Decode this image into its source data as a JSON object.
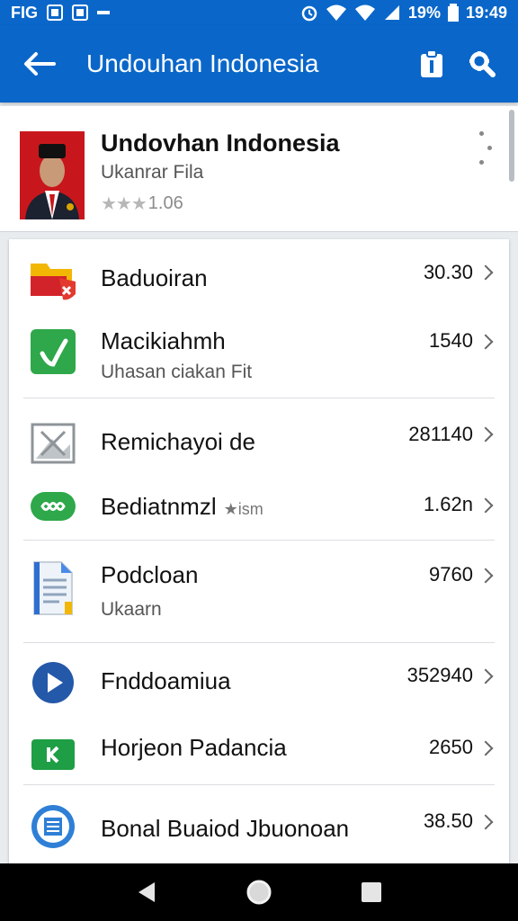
{
  "status_bar": {
    "left_text": "FIG",
    "battery_percent": "19%",
    "time": "19:49",
    "icons": [
      "square-icon",
      "square-icon",
      "dash-icon",
      "alarm-icon",
      "wifi-icon",
      "wifi-icon",
      "signal-icon",
      "battery-icon"
    ]
  },
  "app_bar": {
    "title": "Undouhan Indonesia",
    "back_icon": "back-arrow-icon",
    "action_icons": [
      "clipboard-icon",
      "settings-icon"
    ],
    "color": "#0a67c9"
  },
  "app_header": {
    "title": "Undovhan Indonesia",
    "subtitle": "Ukanrar Fila",
    "rating_stars": "★★★",
    "rating_value": "1.06",
    "overflow_icon": "more-vertical-icon"
  },
  "list": {
    "items": [
      {
        "label": "Baduoiran",
        "sub": "",
        "value": "30.30",
        "icon": "folder-icon",
        "extra": ""
      },
      {
        "label": "Macikiahmh",
        "sub": "Uhasan ciakan Fit",
        "value": "1540",
        "icon": "check-icon",
        "extra": ""
      },
      {
        "label": "Remichayoi de",
        "sub": "",
        "value": "281140",
        "icon": "image-icon",
        "extra": ""
      },
      {
        "label": "Bediatnmzl",
        "sub": "",
        "value": "1.62n",
        "icon": "infinity-icon",
        "extra": "★ism"
      },
      {
        "label": "Podcloan",
        "sub": "Ukaarn",
        "value": "9760",
        "icon": "document-icon",
        "extra": ""
      },
      {
        "label": "Fnddoamiua",
        "sub": "",
        "value": "352940",
        "icon": "play-icon",
        "extra": ""
      },
      {
        "label": "Horjeon Padancia",
        "sub": "",
        "value": "2650",
        "icon": "k-icon",
        "extra": ""
      },
      {
        "label": "Bonal Buaiod Jbuonoan",
        "sub": "",
        "value": "38.50",
        "icon": "archive-icon",
        "extra": ""
      }
    ]
  },
  "nav_bar": {
    "icons": [
      "back-triangle-icon",
      "home-circle-icon",
      "recents-square-icon"
    ]
  }
}
